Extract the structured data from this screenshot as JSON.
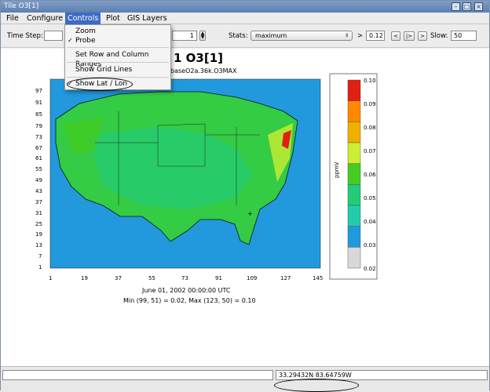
{
  "window": {
    "title": "Tile O3[1]"
  },
  "menubar": {
    "items": [
      "File",
      "Configure",
      "Controls",
      "Plot",
      "GIS Layers"
    ]
  },
  "toolbar": {
    "time_step_label": "Time Step:",
    "time_step_value": "1",
    "stats_label": "Stats:",
    "stats_selected": "maximum",
    "gt_symbol": ">",
    "threshold_value": "0.12",
    "nav_prev": "<",
    "nav_play": "|>",
    "nav_next": ">",
    "slow_label": "Slow:",
    "slow_value": "50"
  },
  "dropdown": {
    "items": [
      {
        "label": "Zoom",
        "checked": false
      },
      {
        "label": "Probe",
        "checked": true
      },
      {
        "label": "Set Row and Column Ranges",
        "checked": false
      },
      {
        "label": "Show Grid Lines",
        "checked": false
      },
      {
        "label": "Show Lat / Lon",
        "checked": true
      }
    ],
    "check_mark": "✓"
  },
  "plot": {
    "title_visible": "1 O3[1]",
    "subtitle_visible": "baseO2a.36k.O3MAX",
    "y_ticks": [
      "97",
      "91",
      "85",
      "79",
      "73",
      "67",
      "61",
      "55",
      "49",
      "43",
      "37",
      "31",
      "25",
      "19",
      "13",
      "7",
      "1"
    ],
    "x_ticks": [
      "1",
      "19",
      "37",
      "55",
      "73",
      "91",
      "109",
      "127",
      "145"
    ],
    "footer_date": "June 01, 2002 00:00:00 UTC",
    "footer_minmax": "Min (99, 51) = 0.02, Max (123, 50) = 0.10"
  },
  "legend": {
    "unit_label": "ppmV",
    "labels": [
      "0.10",
      "0.09",
      "0.08",
      "0.07",
      "0.06",
      "0.05",
      "0.04",
      "0.03",
      "0.02"
    ],
    "colors": [
      "#e02010",
      "#ff8800",
      "#f0b000",
      "#ccee33",
      "#44cc22",
      "#22cc77",
      "#22ccaa",
      "#2299dd",
      "#d8d8d8"
    ]
  },
  "status": {
    "coordinate": "33.29432N 83.64759W"
  }
}
